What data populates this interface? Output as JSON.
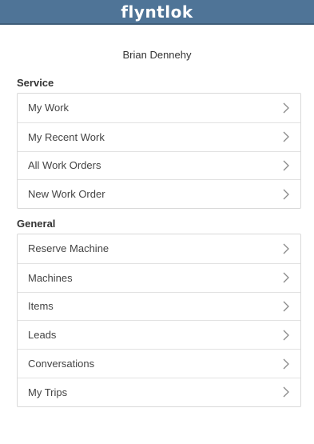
{
  "header": {
    "logo_text": "flyntlok",
    "brand_color": "#4f7497"
  },
  "user": {
    "name": "Brian Dennehy"
  },
  "sections": [
    {
      "title": "Service",
      "items": [
        {
          "label": "My Work",
          "icon": "chevron-right-icon"
        },
        {
          "label": "My Recent Work",
          "icon": "chevron-right-icon"
        },
        {
          "label": "All Work Orders",
          "icon": "chevron-right-icon"
        },
        {
          "label": "New Work Order",
          "icon": "chevron-right-icon"
        }
      ]
    },
    {
      "title": "General",
      "items": [
        {
          "label": "Reserve Machine",
          "icon": "chevron-right-icon"
        },
        {
          "label": "Machines",
          "icon": "chevron-right-icon"
        },
        {
          "label": "Items",
          "icon": "chevron-right-icon"
        },
        {
          "label": "Leads",
          "icon": "chevron-right-icon"
        },
        {
          "label": "Conversations",
          "icon": "chevron-right-icon"
        },
        {
          "label": "My Trips",
          "icon": "chevron-right-icon"
        }
      ]
    }
  ]
}
